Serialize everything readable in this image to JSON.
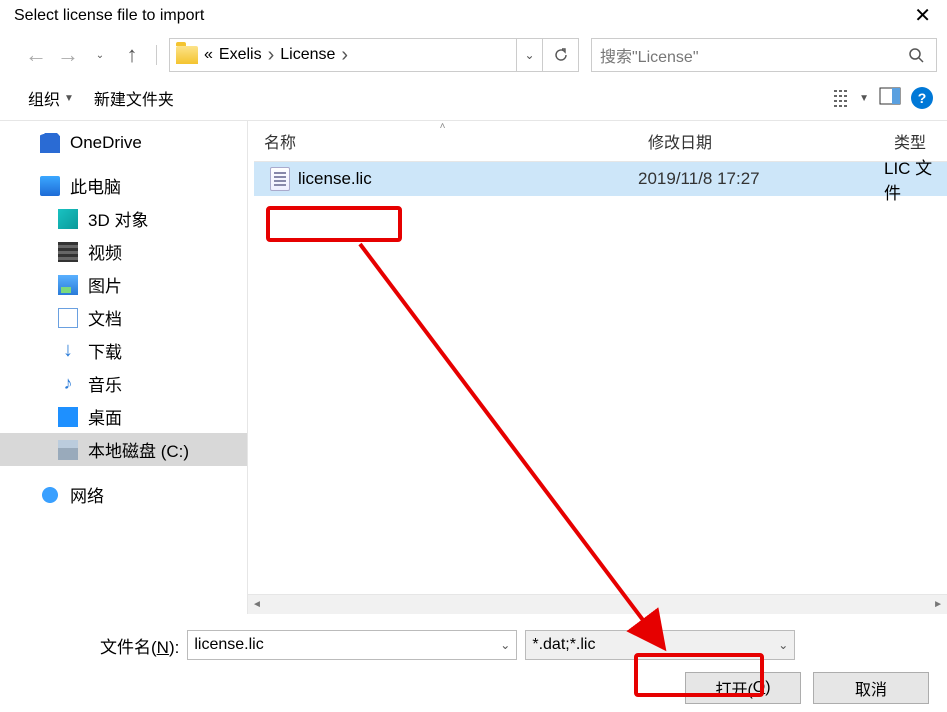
{
  "title": "Select license file to import",
  "breadcrumb": {
    "prefix": "«",
    "p1": "Exelis",
    "p2": "License"
  },
  "search_placeholder": "搜索\"License\"",
  "toolbar": {
    "organize": "组织",
    "newfolder": "新建文件夹"
  },
  "columns": {
    "name": "名称",
    "date": "修改日期",
    "type": "类型"
  },
  "file": {
    "name": "license.lic",
    "date": "2019/11/8 17:27",
    "type": "LIC 文件"
  },
  "tree": {
    "onedrive": "OneDrive",
    "thispc": "此电脑",
    "obj3d": "3D 对象",
    "video": "视频",
    "pictures": "图片",
    "docs": "文档",
    "downloads": "下载",
    "music": "音乐",
    "desktop": "桌面",
    "cdrive": "本地磁盘 (C:)",
    "network": "网络"
  },
  "filename_label_pre": "文件名(",
  "filename_label_u": "N",
  "filename_label_post": "):",
  "filename_value": "license.lic",
  "filter_value": "*.dat;*.lic",
  "open_pre": "打开(",
  "open_u": "O",
  "open_post": ")",
  "cancel": "取消"
}
